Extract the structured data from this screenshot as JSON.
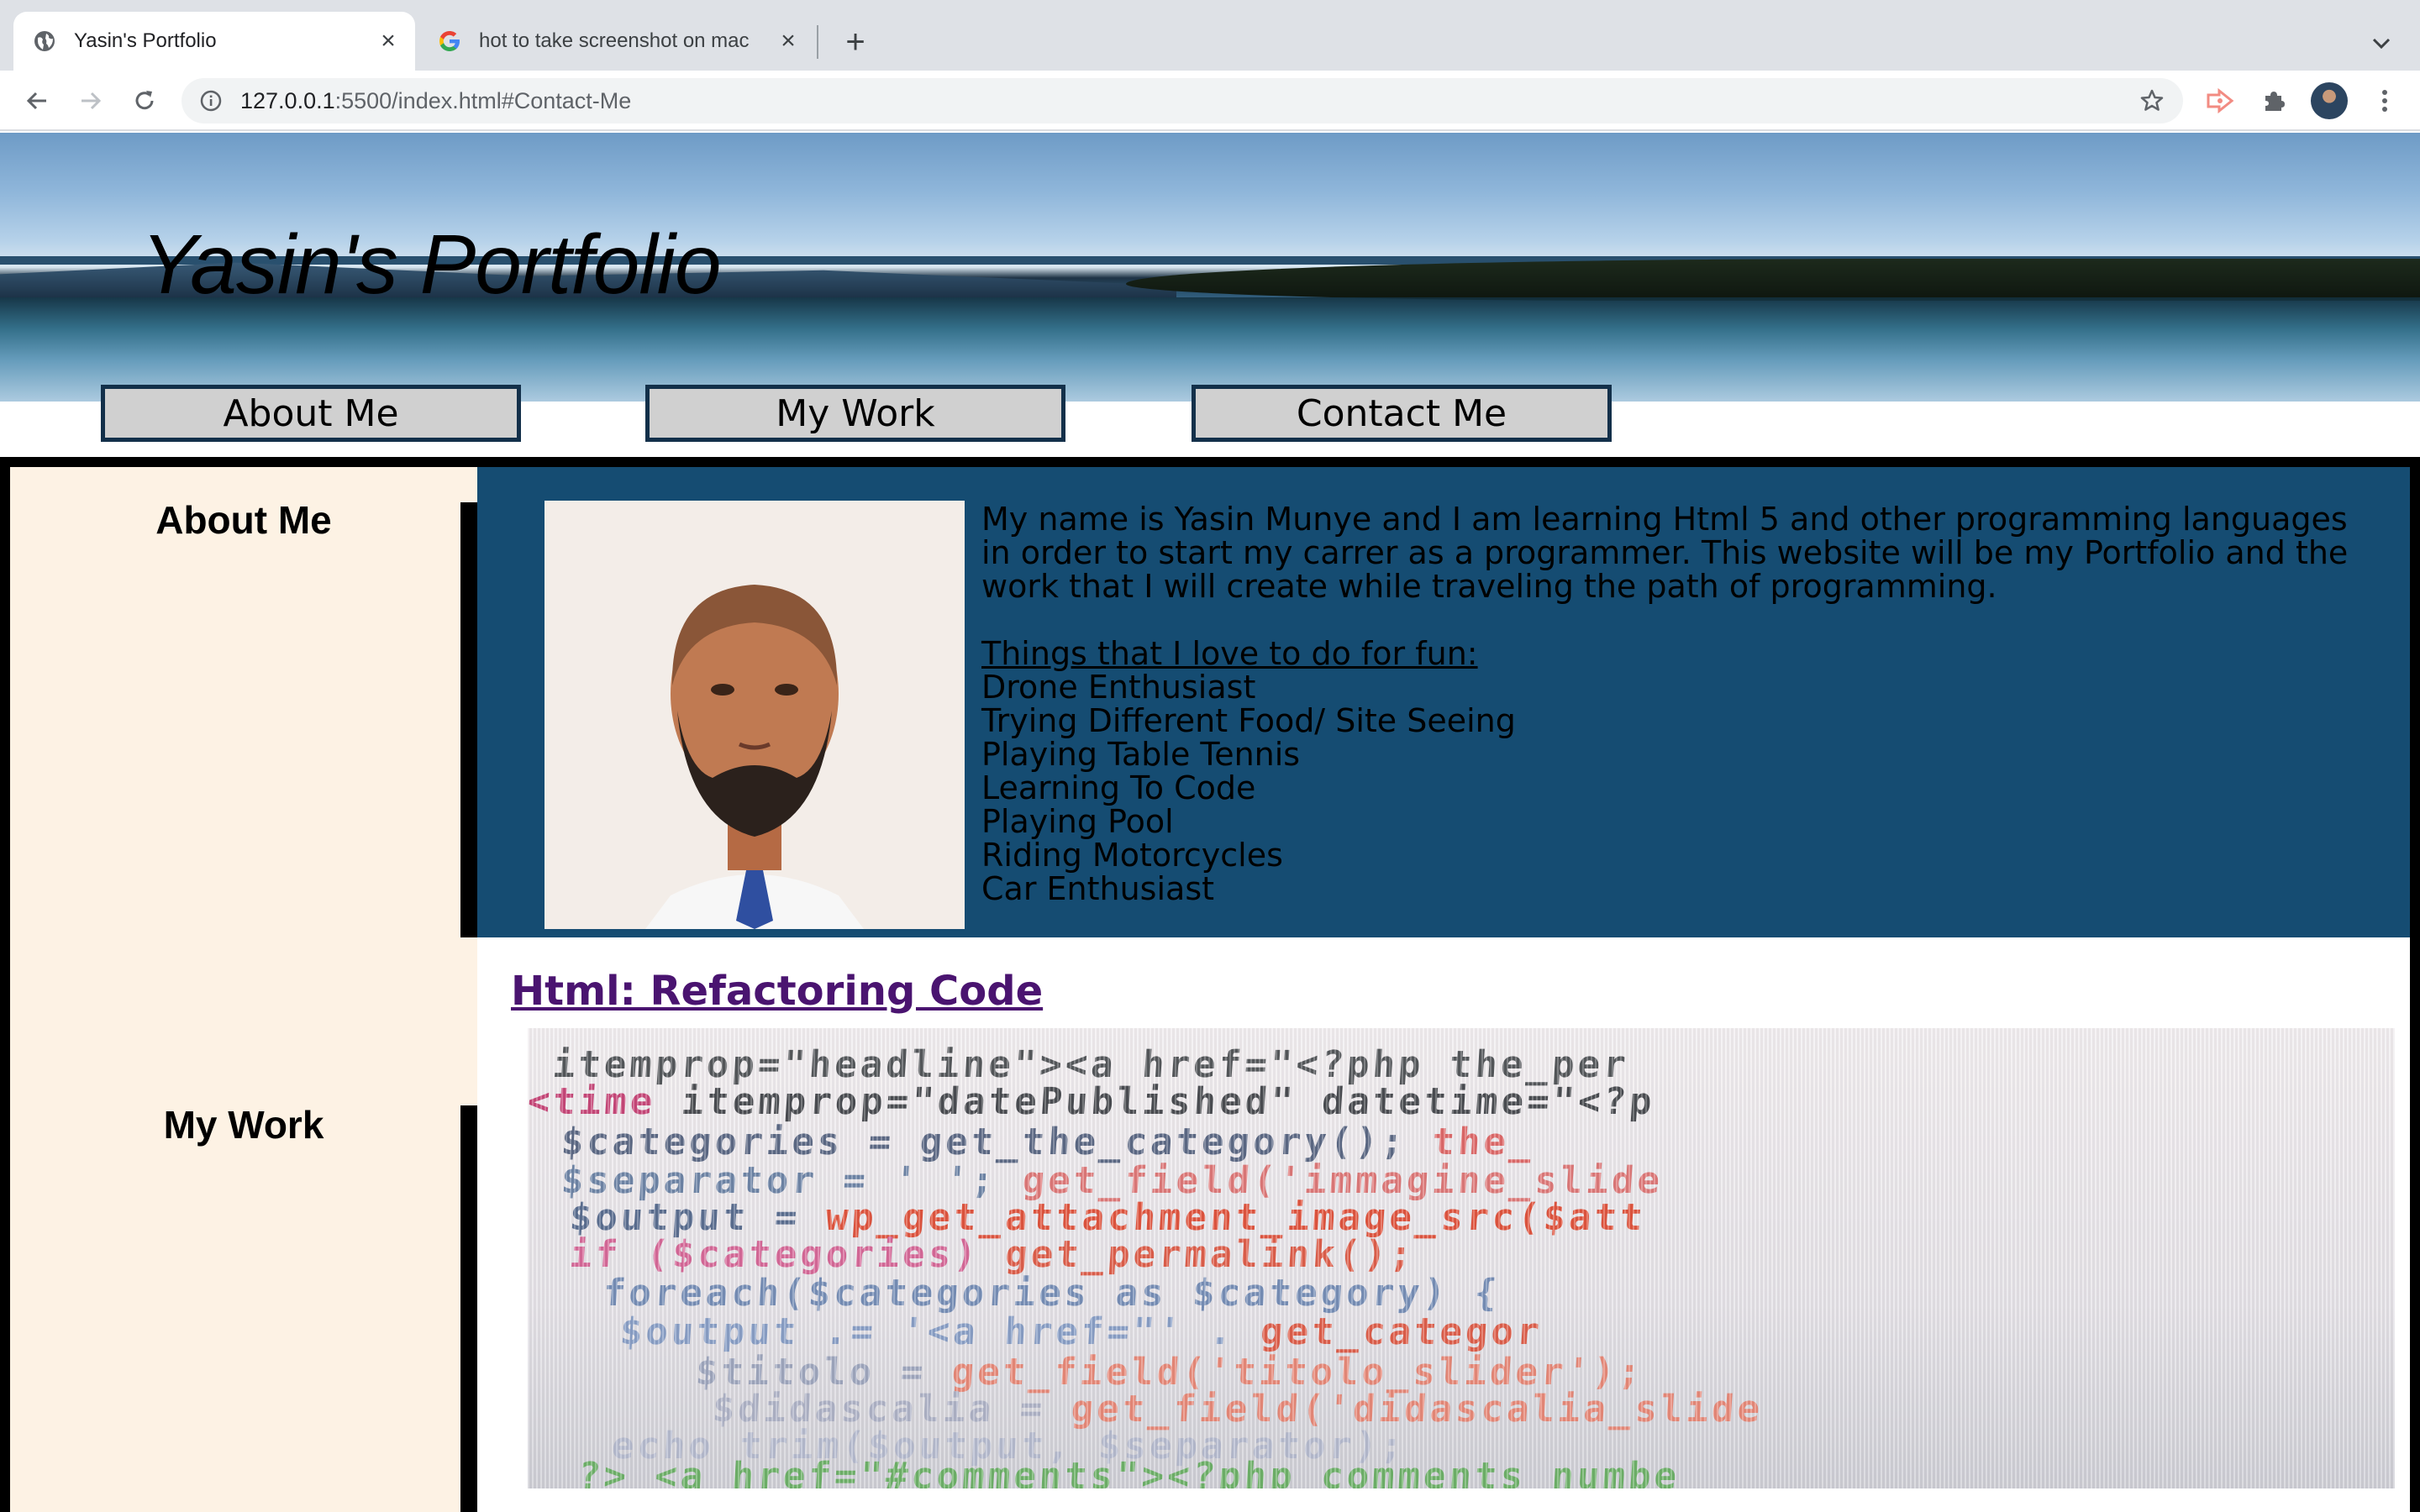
{
  "browser": {
    "tabs": [
      {
        "title": "Yasin's Portfolio",
        "active": true
      },
      {
        "title": "hot to take screenshot on mac",
        "active": false
      }
    ],
    "url_host": "127.0.0.1",
    "url_rest": ":5500/index.html#Contact-Me",
    "colors": {
      "tabstrip": "#dee1e6",
      "toolbar": "#ffffff",
      "omnibox": "#f1f3f4"
    }
  },
  "site": {
    "title": "Yasin's Portfolio",
    "nav": [
      "About Me",
      "My Work",
      "Contact Me"
    ],
    "sidebar": {
      "about_heading": "About Me",
      "work_heading": "My Work"
    },
    "about": {
      "bio": "My name is Yasin Munye and I am learning Html 5 and other programming languages in order to start my carrer as a programmer. This website will be my Portfolio and the work that I will create while traveling the path of programming.",
      "fun_title": "Things that I love to do for fun:",
      "fun_list": [
        "Drone Enthusiast",
        "Trying Different Food/ Site Seeing",
        "Playing Table Tennis",
        "Learning To Code",
        "Playing Pool",
        "Riding Motorcycles",
        "Car Enthusiast"
      ]
    },
    "work": {
      "link_text": "Html: Refactoring Code"
    },
    "colors": {
      "about_bg": "#154c72",
      "sidebar_bg": "#fdf2e4",
      "link": "#4a1470",
      "nav_bg": "#d0d0d0",
      "nav_border": "#13304a"
    }
  }
}
